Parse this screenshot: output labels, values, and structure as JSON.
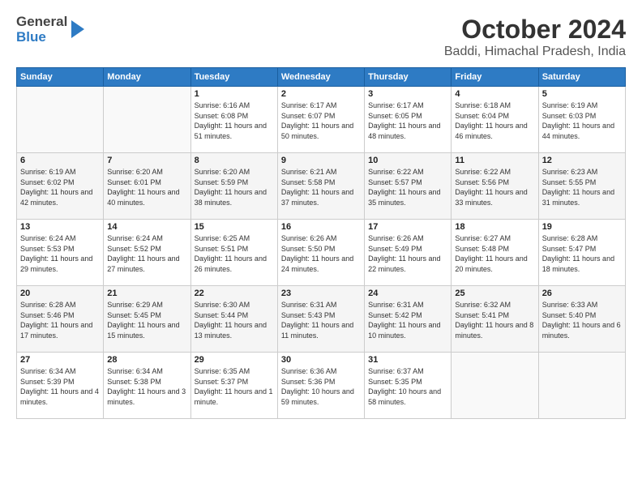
{
  "logo": {
    "general": "General",
    "blue": "Blue"
  },
  "title": "October 2024",
  "subtitle": "Baddi, Himachal Pradesh, India",
  "days_of_week": [
    "Sunday",
    "Monday",
    "Tuesday",
    "Wednesday",
    "Thursday",
    "Friday",
    "Saturday"
  ],
  "weeks": [
    [
      {
        "day": "",
        "sunrise": "",
        "sunset": "",
        "daylight": ""
      },
      {
        "day": "",
        "sunrise": "",
        "sunset": "",
        "daylight": ""
      },
      {
        "day": "1",
        "sunrise": "Sunrise: 6:16 AM",
        "sunset": "Sunset: 6:08 PM",
        "daylight": "Daylight: 11 hours and 51 minutes."
      },
      {
        "day": "2",
        "sunrise": "Sunrise: 6:17 AM",
        "sunset": "Sunset: 6:07 PM",
        "daylight": "Daylight: 11 hours and 50 minutes."
      },
      {
        "day": "3",
        "sunrise": "Sunrise: 6:17 AM",
        "sunset": "Sunset: 6:05 PM",
        "daylight": "Daylight: 11 hours and 48 minutes."
      },
      {
        "day": "4",
        "sunrise": "Sunrise: 6:18 AM",
        "sunset": "Sunset: 6:04 PM",
        "daylight": "Daylight: 11 hours and 46 minutes."
      },
      {
        "day": "5",
        "sunrise": "Sunrise: 6:19 AM",
        "sunset": "Sunset: 6:03 PM",
        "daylight": "Daylight: 11 hours and 44 minutes."
      }
    ],
    [
      {
        "day": "6",
        "sunrise": "Sunrise: 6:19 AM",
        "sunset": "Sunset: 6:02 PM",
        "daylight": "Daylight: 11 hours and 42 minutes."
      },
      {
        "day": "7",
        "sunrise": "Sunrise: 6:20 AM",
        "sunset": "Sunset: 6:01 PM",
        "daylight": "Daylight: 11 hours and 40 minutes."
      },
      {
        "day": "8",
        "sunrise": "Sunrise: 6:20 AM",
        "sunset": "Sunset: 5:59 PM",
        "daylight": "Daylight: 11 hours and 38 minutes."
      },
      {
        "day": "9",
        "sunrise": "Sunrise: 6:21 AM",
        "sunset": "Sunset: 5:58 PM",
        "daylight": "Daylight: 11 hours and 37 minutes."
      },
      {
        "day": "10",
        "sunrise": "Sunrise: 6:22 AM",
        "sunset": "Sunset: 5:57 PM",
        "daylight": "Daylight: 11 hours and 35 minutes."
      },
      {
        "day": "11",
        "sunrise": "Sunrise: 6:22 AM",
        "sunset": "Sunset: 5:56 PM",
        "daylight": "Daylight: 11 hours and 33 minutes."
      },
      {
        "day": "12",
        "sunrise": "Sunrise: 6:23 AM",
        "sunset": "Sunset: 5:55 PM",
        "daylight": "Daylight: 11 hours and 31 minutes."
      }
    ],
    [
      {
        "day": "13",
        "sunrise": "Sunrise: 6:24 AM",
        "sunset": "Sunset: 5:53 PM",
        "daylight": "Daylight: 11 hours and 29 minutes."
      },
      {
        "day": "14",
        "sunrise": "Sunrise: 6:24 AM",
        "sunset": "Sunset: 5:52 PM",
        "daylight": "Daylight: 11 hours and 27 minutes."
      },
      {
        "day": "15",
        "sunrise": "Sunrise: 6:25 AM",
        "sunset": "Sunset: 5:51 PM",
        "daylight": "Daylight: 11 hours and 26 minutes."
      },
      {
        "day": "16",
        "sunrise": "Sunrise: 6:26 AM",
        "sunset": "Sunset: 5:50 PM",
        "daylight": "Daylight: 11 hours and 24 minutes."
      },
      {
        "day": "17",
        "sunrise": "Sunrise: 6:26 AM",
        "sunset": "Sunset: 5:49 PM",
        "daylight": "Daylight: 11 hours and 22 minutes."
      },
      {
        "day": "18",
        "sunrise": "Sunrise: 6:27 AM",
        "sunset": "Sunset: 5:48 PM",
        "daylight": "Daylight: 11 hours and 20 minutes."
      },
      {
        "day": "19",
        "sunrise": "Sunrise: 6:28 AM",
        "sunset": "Sunset: 5:47 PM",
        "daylight": "Daylight: 11 hours and 18 minutes."
      }
    ],
    [
      {
        "day": "20",
        "sunrise": "Sunrise: 6:28 AM",
        "sunset": "Sunset: 5:46 PM",
        "daylight": "Daylight: 11 hours and 17 minutes."
      },
      {
        "day": "21",
        "sunrise": "Sunrise: 6:29 AM",
        "sunset": "Sunset: 5:45 PM",
        "daylight": "Daylight: 11 hours and 15 minutes."
      },
      {
        "day": "22",
        "sunrise": "Sunrise: 6:30 AM",
        "sunset": "Sunset: 5:44 PM",
        "daylight": "Daylight: 11 hours and 13 minutes."
      },
      {
        "day": "23",
        "sunrise": "Sunrise: 6:31 AM",
        "sunset": "Sunset: 5:43 PM",
        "daylight": "Daylight: 11 hours and 11 minutes."
      },
      {
        "day": "24",
        "sunrise": "Sunrise: 6:31 AM",
        "sunset": "Sunset: 5:42 PM",
        "daylight": "Daylight: 11 hours and 10 minutes."
      },
      {
        "day": "25",
        "sunrise": "Sunrise: 6:32 AM",
        "sunset": "Sunset: 5:41 PM",
        "daylight": "Daylight: 11 hours and 8 minutes."
      },
      {
        "day": "26",
        "sunrise": "Sunrise: 6:33 AM",
        "sunset": "Sunset: 5:40 PM",
        "daylight": "Daylight: 11 hours and 6 minutes."
      }
    ],
    [
      {
        "day": "27",
        "sunrise": "Sunrise: 6:34 AM",
        "sunset": "Sunset: 5:39 PM",
        "daylight": "Daylight: 11 hours and 4 minutes."
      },
      {
        "day": "28",
        "sunrise": "Sunrise: 6:34 AM",
        "sunset": "Sunset: 5:38 PM",
        "daylight": "Daylight: 11 hours and 3 minutes."
      },
      {
        "day": "29",
        "sunrise": "Sunrise: 6:35 AM",
        "sunset": "Sunset: 5:37 PM",
        "daylight": "Daylight: 11 hours and 1 minute."
      },
      {
        "day": "30",
        "sunrise": "Sunrise: 6:36 AM",
        "sunset": "Sunset: 5:36 PM",
        "daylight": "Daylight: 10 hours and 59 minutes."
      },
      {
        "day": "31",
        "sunrise": "Sunrise: 6:37 AM",
        "sunset": "Sunset: 5:35 PM",
        "daylight": "Daylight: 10 hours and 58 minutes."
      },
      {
        "day": "",
        "sunrise": "",
        "sunset": "",
        "daylight": ""
      },
      {
        "day": "",
        "sunrise": "",
        "sunset": "",
        "daylight": ""
      }
    ]
  ]
}
